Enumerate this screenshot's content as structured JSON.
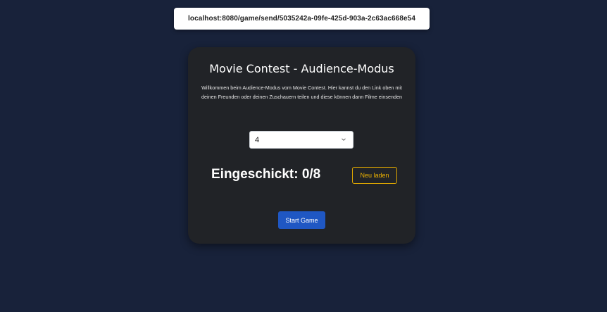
{
  "address_bar": {
    "url": "localhost:8080/game/send/5035242a-09fe-425d-903a-2c63ac668e54"
  },
  "card": {
    "title": "Movie Contest - Audience-Modus",
    "description": "Willkommen beim Audience-Modus vom Movie Contest. Hier kannst du den Link oben mit deinen Freunden oder deinen Zuschauern teilen und diese können dann Filme einsenden",
    "select": {
      "selected_value": "4",
      "icon": "chevron-down-icon"
    },
    "submitted_text": "Eingeschickt: 0/8",
    "reload_button": "Neu laden",
    "start_button": "Start Game"
  },
  "colors": {
    "background": "#18223a",
    "card": "#212327",
    "reload_accent": "#f0b400",
    "start_button": "#1f57c3"
  }
}
